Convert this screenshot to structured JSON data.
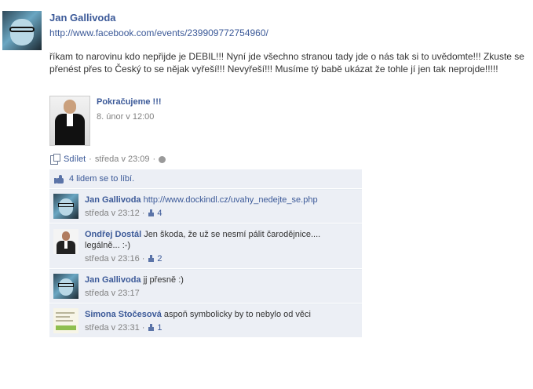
{
  "post": {
    "author": "Jan Gallivoda",
    "link": "http://www.facebook.com/events/239909772754960/",
    "message": "říkam to narovinu kdo nepřijde je DEBIL!!! Nyní jde všechno stranou tady jde o nás tak si to uvědomte!!! Zkuste se přenést přes to Český to se nějak vyřeší!!! Nevyřeší!!! Musíme tý babě ukázat že tohle jí jen tak neprojde!!!!!",
    "attachment": {
      "title": "Pokračujeme !!!",
      "date": "8. únor v 12:00"
    },
    "actions": {
      "share_label": "Sdílet",
      "separator": "·",
      "timestamp": "středa v 23:09"
    },
    "likes_text": "4 lidem se to líbí."
  },
  "comments": [
    {
      "author": "Jan Gallivoda",
      "text": "http://www.dockindl.cz/uvahy_nedejte_se.php",
      "time": "středa v 23:12",
      "likes": "4"
    },
    {
      "author": "Ondřej Dostál",
      "text": "Jen škoda, že už se nesmí pálit čarodějnice.... legálně... :-)",
      "time": "středa v 23:16",
      "likes": "2"
    },
    {
      "author": "Jan Gallivoda",
      "text": "jj přesně :)",
      "time": "středa v 23:17",
      "likes": ""
    },
    {
      "author": "Simona Stočesová",
      "text": "aspoň symbolicky by to nebylo od věci",
      "time": "středa v 23:31",
      "likes": "1"
    }
  ],
  "colors": {
    "link": "#3b5998",
    "comments_bg": "#eceff5",
    "meta_gray": "#808080"
  }
}
